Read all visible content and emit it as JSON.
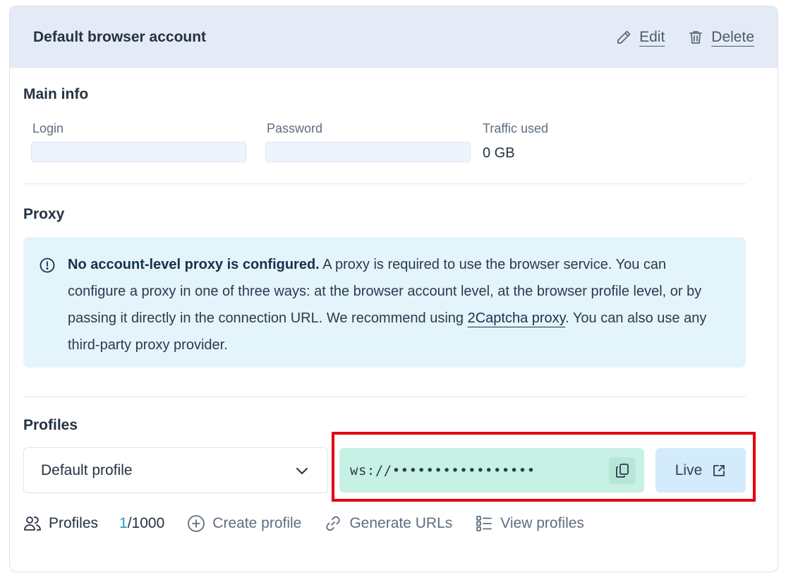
{
  "header": {
    "title": "Default browser account",
    "edit_label": "Edit",
    "delete_label": "Delete"
  },
  "main_info": {
    "title": "Main info",
    "login_label": "Login",
    "login_value": "",
    "password_label": "Password",
    "password_value": "",
    "traffic_label": "Traffic used",
    "traffic_value": "0 GB"
  },
  "proxy": {
    "title": "Proxy",
    "notice_bold": "No account-level proxy is configured.",
    "notice_text": " A proxy is required to use the browser service. You can configure a proxy in one of three ways: at the browser account level, at the browser profile level, or by passing it directly in the connection URL. We recommend using ",
    "notice_link": "2Captcha proxy",
    "notice_tail": ". You can also use any third-party proxy provider."
  },
  "profiles": {
    "title": "Profiles",
    "selected_profile": "Default profile",
    "ws_url": "ws://•••••••••••••••••",
    "live_label": "Live",
    "count_label": "Profiles",
    "count_current": "1",
    "count_max": "/1000",
    "create_label": "Create profile",
    "generate_label": "Generate URLs",
    "view_label": "View profiles"
  },
  "colors": {
    "header_bg": "#e4ebf6",
    "notice_bg": "#e4f4fb",
    "ws_bg": "#c8f1e5",
    "live_bg": "#d3ebfb",
    "highlight": "#e3000f",
    "accent": "#1a9fbf"
  }
}
